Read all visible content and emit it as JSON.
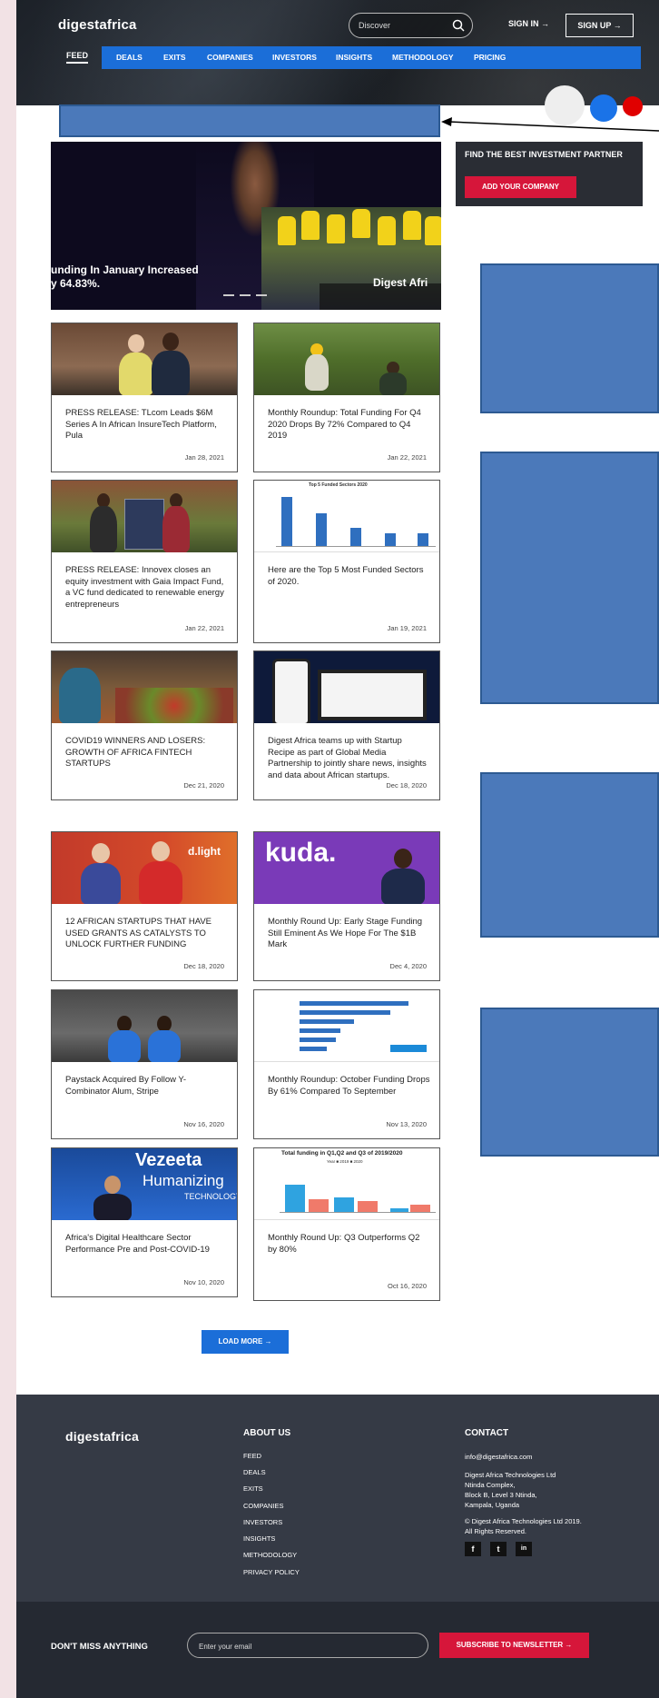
{
  "header": {
    "logo": "digestafrica",
    "search_placeholder": "Discover",
    "sign_in": "SIGN IN →",
    "sign_up": "SIGN UP →",
    "nav": [
      "FEED",
      "DEALS",
      "EXITS",
      "COMPANIES",
      "INVESTORS",
      "INSIGHTS",
      "METHODOLOGY",
      "PRICING"
    ]
  },
  "dots_colors": [
    "#eeeeee",
    "#1a73e8",
    "#e00000"
  ],
  "slider": {
    "caption_left_line1": "unding In January Increased",
    "caption_left_line2": "y 64.83%.",
    "caption_right": "Digest Afri"
  },
  "sidebar": {
    "partner_title": "FIND THE BEST INVESTMENT PARTNER",
    "partner_button": "ADD YOUR COMPANY"
  },
  "cards": [
    {
      "title": "PRESS RELEASE: TLcom Leads $6M Series A In African InsureTech Platform, Pula",
      "date": "Jan 28, 2021"
    },
    {
      "title": "Monthly Roundup: Total Funding For Q4 2020 Drops By 72% Compared to Q4 2019",
      "date": "Jan 22, 2021"
    },
    {
      "title": "PRESS RELEASE: Innovex closes an equity investment with Gaia Impact Fund, a VC fund dedicated to renewable energy entrepreneurs",
      "date": "Jan 22, 2021"
    },
    {
      "title": "Here are the Top 5 Most Funded Sectors of 2020.",
      "date": "Jan 19, 2021"
    },
    {
      "title": "COVID19 WINNERS AND LOSERS: GROWTH OF AFRICA FINTECH STARTUPS",
      "date": "Dec 21, 2020"
    },
    {
      "title": "Digest Africa teams up with Startup Recipe as part of Global Media Partnership to jointly share news, insights and data about African startups.",
      "date": "Dec 18, 2020"
    },
    {
      "title": "12 AFRICAN STARTUPS THAT HAVE USED GRANTS AS CATALYSTS TO UNLOCK FURTHER FUNDING",
      "date": "Dec 18, 2020"
    },
    {
      "title": "Monthly Round Up: Early Stage Funding Still Eminent As We Hope For The $1B Mark",
      "date": "Dec 4, 2020"
    },
    {
      "title": "Paystack Acquired By Follow Y-Combinator Alum, Stripe",
      "date": "Nov 16, 2020"
    },
    {
      "title": "Monthly Roundup: October Funding Drops By 61% Compared To September",
      "date": "Nov 13, 2020"
    },
    {
      "title": "Africa's Digital Healthcare Sector Performance Pre and Post-COVID-19",
      "date": "Nov 10, 2020"
    },
    {
      "title": "Monthly Round Up: Q3 Outperforms Q2 by 80%",
      "date": "Oct 16, 2020"
    }
  ],
  "image_text": {
    "chart1_title": "Top 5 Funded Sectors 2020",
    "dlight": "d.light",
    "kuda": "kuda.",
    "vezeeta": "Vezeeta",
    "humanizing": "Humanizing",
    "technology": "TECHNOLOGY",
    "chart3_title": "Total funding in Q1,Q2 and Q3 of 2019/2020",
    "chart3_legend": "Year ■ 2019 ■ 2020"
  },
  "load_more": "LOAD MORE →",
  "footer": {
    "logo": "digestafrica",
    "about_heading": "ABOUT US",
    "about_links": [
      "FEED",
      "DEALS",
      "EXITS",
      "COMPANIES",
      "INVESTORS",
      "INSIGHTS",
      "METHODOLOGY",
      "PRIVACY POLICY"
    ],
    "contact_heading": "CONTACT",
    "email": "info@digestafrica.com",
    "address": [
      "Digest Africa Technologies Ltd",
      "Ntinda Complex,",
      "Block B, Level 3 Ntinda,",
      "Kampala, Uganda"
    ],
    "copyright": [
      "© Digest Africa Technologies Ltd 2019.",
      "All Rights Reserved."
    ],
    "social": [
      "f",
      "t",
      "in"
    ]
  },
  "newsletter": {
    "label": "DON'T MISS ANYTHING",
    "placeholder": "Enter your email",
    "button": "SUBSCRIBE TO NEWSLETTER →"
  }
}
